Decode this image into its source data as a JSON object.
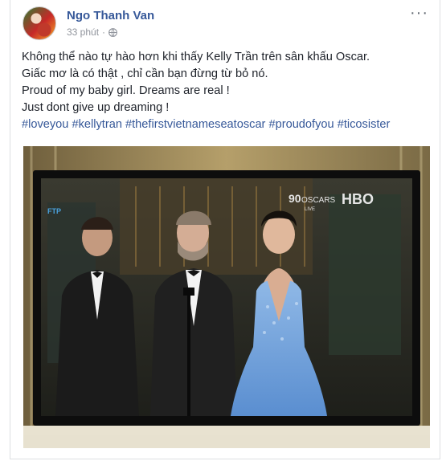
{
  "post": {
    "author": "Ngo Thanh Van",
    "time": "33 phút",
    "lines": [
      "Không thể nào tự hào hơn khi thấy Kelly Trần trên sân khấu Oscar.",
      "Giấc mơ là có thật , chỉ cần bạn đừng từ bỏ nó.",
      "Proud of my baby girl. Dreams are real !",
      "Just dont give up dreaming !"
    ],
    "hashtags": [
      "#loveyou",
      "#kellytran",
      "#thefirstvietnameseatoscar",
      "#proudofyou",
      "#ticosister"
    ]
  },
  "photo": {
    "tv_logo_left": "90",
    "tv_logo_right": "OSCARS",
    "tv_logo_sub": "LIVE",
    "network": "HBO",
    "corner": "FTP"
  },
  "colors": {
    "link": "#365899",
    "meta": "#90949c"
  }
}
